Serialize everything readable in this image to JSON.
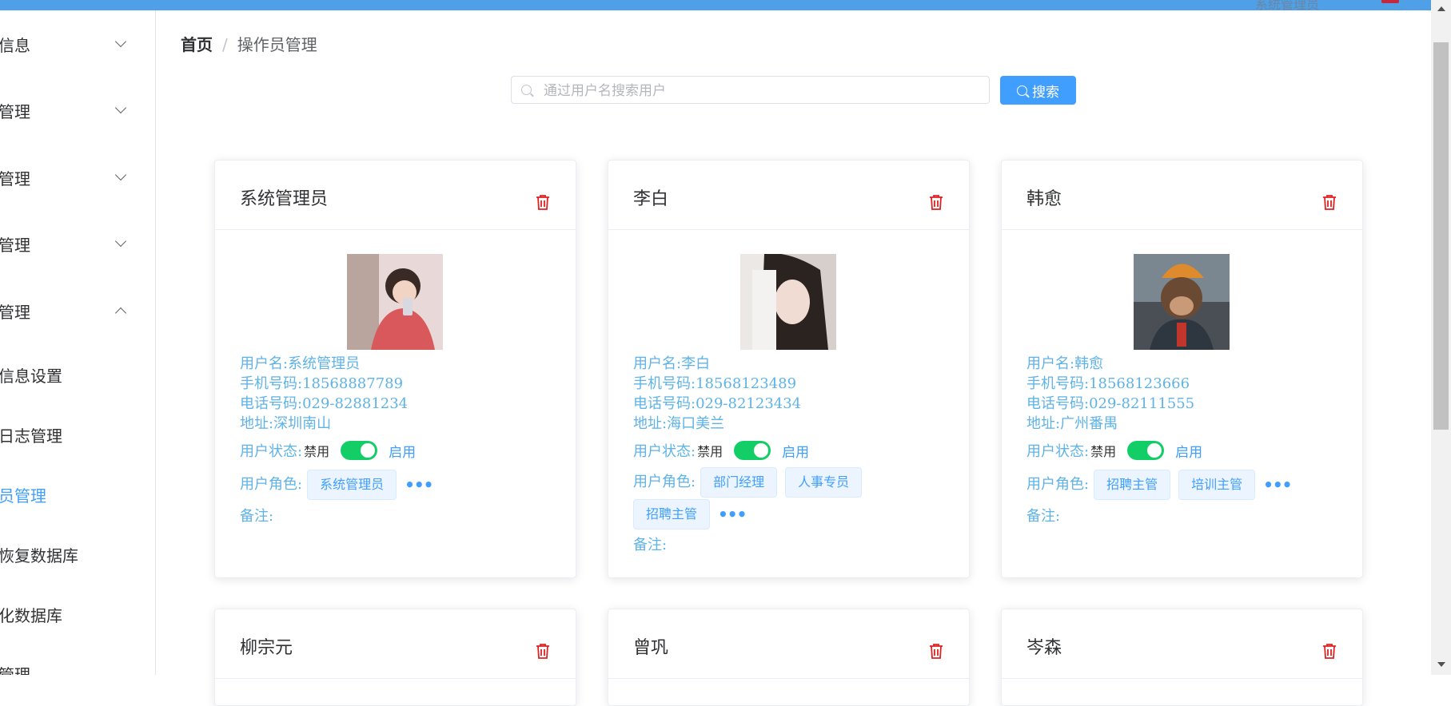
{
  "header": {
    "user_text": "系统管理员"
  },
  "sidebar": {
    "items": [
      {
        "label": "信息"
      },
      {
        "label": "管理"
      },
      {
        "label": "管理"
      },
      {
        "label": "管理"
      },
      {
        "label": "管理"
      },
      {
        "label": "信息设置"
      },
      {
        "label": "日志管理"
      },
      {
        "label": "员管理"
      },
      {
        "label": "恢复数据库"
      },
      {
        "label": "化数据库"
      },
      {
        "label": "管理"
      }
    ]
  },
  "breadcrumb": {
    "home": "首页",
    "separator": "/",
    "current": "操作员管理"
  },
  "search": {
    "placeholder": "通过用户名搜索用户",
    "value": "",
    "button": "搜索"
  },
  "labels": {
    "username": "用户名:",
    "mobile": "手机号码:",
    "phone": "电话号码:",
    "address": "地址:",
    "status": "用户状态:",
    "disabled": "禁用",
    "enabled": "启用",
    "roles": "用户角色:",
    "remark": "备注:",
    "more": "•••"
  },
  "cards": [
    {
      "title": "系统管理员",
      "username": "系统管理员",
      "mobile": "18568887789",
      "phone": "029-82881234",
      "address": "深圳南山",
      "enabled": true,
      "roles": [
        "系统管理员"
      ],
      "remark": ""
    },
    {
      "title": "李白",
      "username": "李白",
      "mobile": "18568123489",
      "phone": "029-82123434",
      "address": "海口美兰",
      "enabled": true,
      "roles": [
        "部门经理",
        "人事专员",
        "招聘主管"
      ],
      "remark": ""
    },
    {
      "title": "韩愈",
      "username": "韩愈",
      "mobile": "18568123666",
      "phone": "029-82111555",
      "address": "广州番禺",
      "enabled": true,
      "roles": [
        "招聘主管",
        "培训主管"
      ],
      "remark": ""
    },
    {
      "title": "柳宗元"
    },
    {
      "title": "曾巩"
    },
    {
      "title": "岑森"
    }
  ],
  "colors": {
    "accent": "#409eff",
    "info_text": "#5fb3e6",
    "switch_on": "#13ce66",
    "delete": "#e02020",
    "topbar": "#4fa0e6"
  }
}
